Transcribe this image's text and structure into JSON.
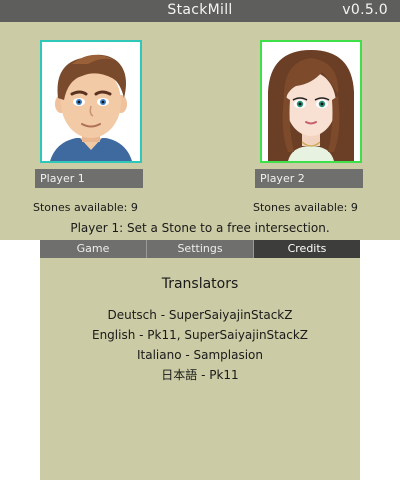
{
  "app": {
    "title": "StackMill",
    "version": "v0.5.0"
  },
  "players": [
    {
      "name": "Player 1",
      "stones_label": "Stones available: 9",
      "portrait_icon": "male-avatar-icon",
      "frame_color": "#2fc8b8"
    },
    {
      "name": "Player 2",
      "stones_label": "Stones available: 9",
      "portrait_icon": "female-avatar-icon",
      "frame_color": "#3ee04a"
    }
  ],
  "status": "Player 1: Set a Stone to a free intersection.",
  "tabs": [
    {
      "label": "Game",
      "active": false
    },
    {
      "label": "Settings",
      "active": false
    },
    {
      "label": "Credits",
      "active": true
    }
  ],
  "credits": {
    "heading": "Translators",
    "entries": [
      "Deutsch - SuperSaiyajinStackZ",
      "English - Pk11, SuperSaiyajinStackZ",
      "Italiano - Samplasion",
      "日本語 - Pk11"
    ]
  },
  "colors": {
    "background": "#cbcba5",
    "titlebar": "#5e5e5c",
    "bar": "#6f6f6d",
    "active_tab": "#3d3d3b"
  }
}
